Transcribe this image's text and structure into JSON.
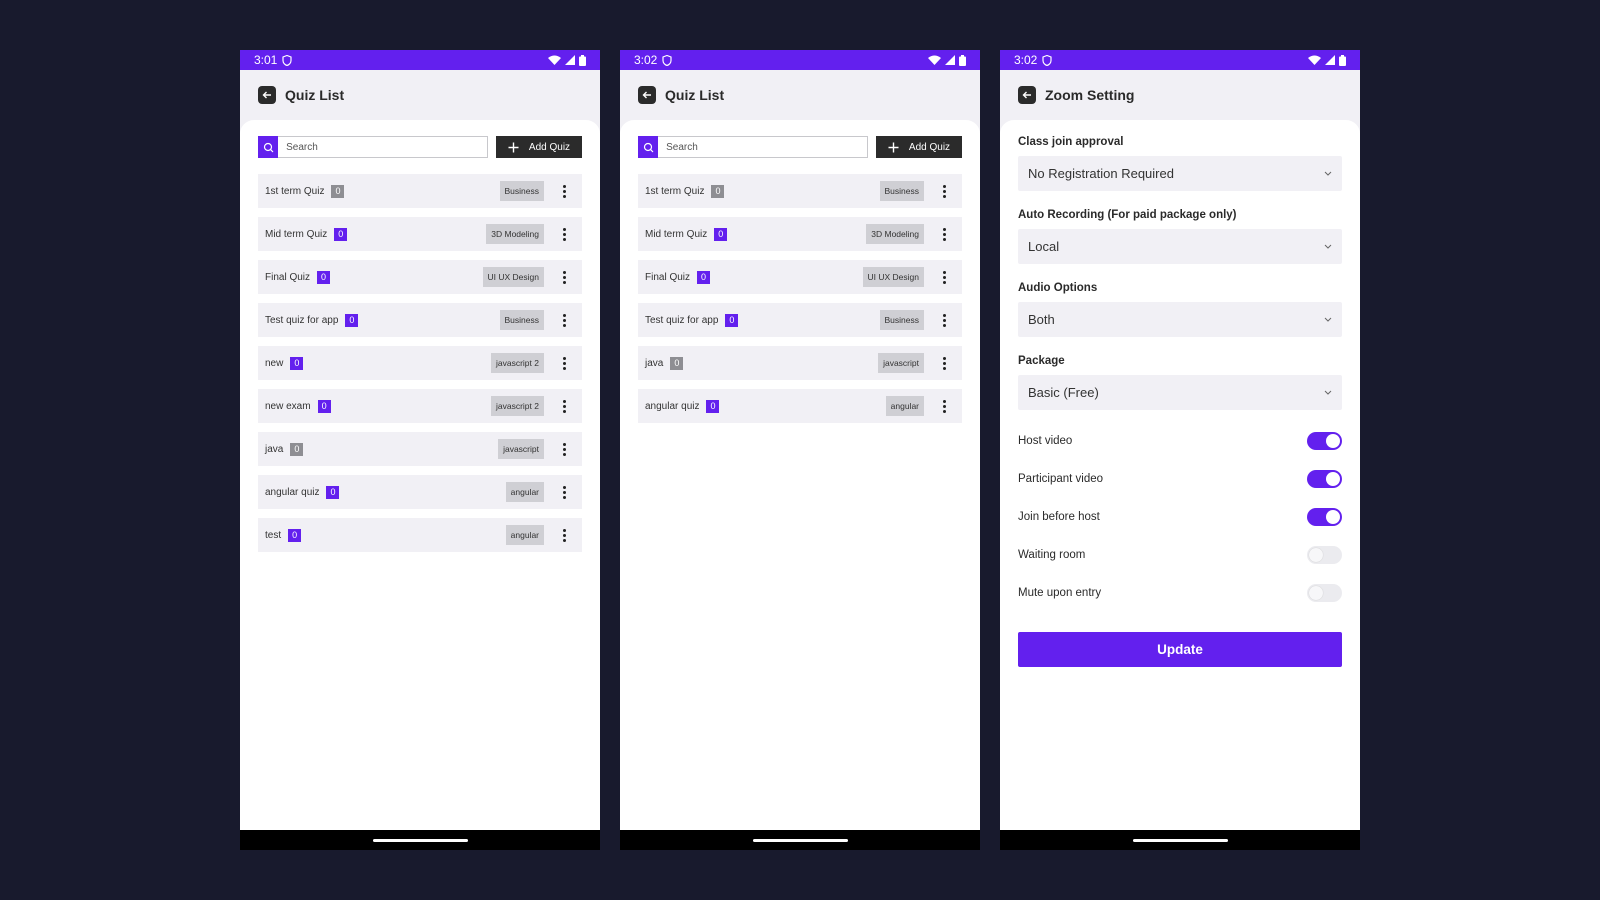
{
  "colors": {
    "background": "#181a2d",
    "accent": "#6320ee",
    "dark_button": "#2b2b2b",
    "gray_badge": "#8e8e93"
  },
  "screen1": {
    "time": "3:01",
    "title": "Quiz List",
    "search_placeholder": "Search",
    "add_label": "Add Quiz",
    "quizzes": [
      {
        "title": "1st term Quiz",
        "count": "0",
        "tag": "Business",
        "badge": "gray"
      },
      {
        "title": "Mid term Quiz",
        "count": "0",
        "tag": "3D Modeling",
        "badge": "purple"
      },
      {
        "title": "Final Quiz",
        "count": "0",
        "tag": "UI UX Design",
        "badge": "purple"
      },
      {
        "title": "Test quiz for app",
        "count": "0",
        "tag": "Business",
        "badge": "purple"
      },
      {
        "title": "new",
        "count": "0",
        "tag": "javascript 2",
        "badge": "purple"
      },
      {
        "title": "new exam",
        "count": "0",
        "tag": "javascript 2",
        "badge": "purple"
      },
      {
        "title": "java",
        "count": "0",
        "tag": "javascript",
        "badge": "gray"
      },
      {
        "title": "angular quiz",
        "count": "0",
        "tag": "angular",
        "badge": "purple"
      },
      {
        "title": "test",
        "count": "0",
        "tag": "angular",
        "badge": "purple"
      }
    ]
  },
  "screen2": {
    "time": "3:02",
    "title": "Quiz List",
    "search_placeholder": "Search",
    "add_label": "Add Quiz",
    "quizzes": [
      {
        "title": "1st term Quiz",
        "count": "0",
        "tag": "Business",
        "badge": "gray"
      },
      {
        "title": "Mid term Quiz",
        "count": "0",
        "tag": "3D Modeling",
        "badge": "purple"
      },
      {
        "title": "Final Quiz",
        "count": "0",
        "tag": "UI UX Design",
        "badge": "purple"
      },
      {
        "title": "Test quiz for app",
        "count": "0",
        "tag": "Business",
        "badge": "purple"
      },
      {
        "title": "java",
        "count": "0",
        "tag": "javascript",
        "badge": "gray"
      },
      {
        "title": "angular quiz",
        "count": "0",
        "tag": "angular",
        "badge": "purple"
      }
    ]
  },
  "screen3": {
    "time": "3:02",
    "title": "Zoom Setting",
    "fields": [
      {
        "label": "Class join approval",
        "value": "No Registration Required"
      },
      {
        "label": "Auto Recording (For paid package only)",
        "value": "Local"
      },
      {
        "label": "Audio Options",
        "value": "Both"
      },
      {
        "label": "Package",
        "value": "Basic (Free)"
      }
    ],
    "toggles": [
      {
        "label": "Host video",
        "on": true
      },
      {
        "label": "Participant video",
        "on": true
      },
      {
        "label": "Join before host",
        "on": true
      },
      {
        "label": "Waiting room",
        "on": false
      },
      {
        "label": "Mute upon entry",
        "on": false
      }
    ],
    "update_label": "Update"
  }
}
